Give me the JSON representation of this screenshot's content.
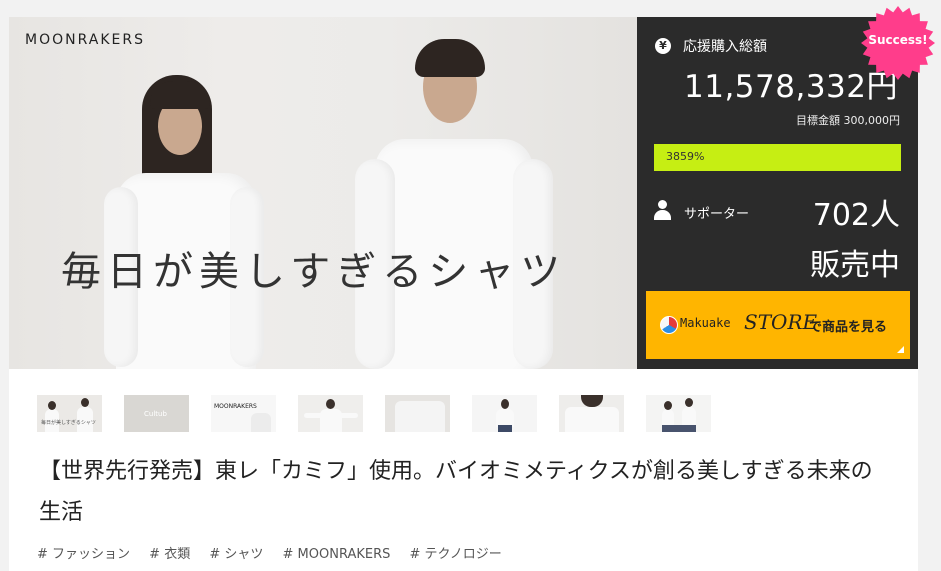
{
  "hero": {
    "brand": "MOONRAKERS",
    "tagline": "毎日が美しすぎるシャツ"
  },
  "panel": {
    "amount_label": "応援購入総額",
    "amount": "11,578,332円",
    "goal": "目標金額 300,000円",
    "progress_text": "3859%",
    "progress_percent": 3859,
    "supporter_label": "サポーター",
    "supporter_count": "702人",
    "status": "販売中",
    "success_badge": "Success!",
    "store_button": {
      "brand": "Makuake",
      "store": "STORE",
      "label": "で商品を見る"
    }
  },
  "thumbnails": [
    {
      "name": "thumb-1",
      "caption": "毎日が美しすぎるシャツ"
    },
    {
      "name": "thumb-2",
      "caption": "Cultub"
    },
    {
      "name": "thumb-3",
      "caption": "MOONRAKERS"
    },
    {
      "name": "thumb-4",
      "caption": ""
    },
    {
      "name": "thumb-5",
      "caption": ""
    },
    {
      "name": "thumb-6",
      "caption": ""
    },
    {
      "name": "thumb-7",
      "caption": ""
    },
    {
      "name": "thumb-8",
      "caption": ""
    }
  ],
  "title": "【世界先行発売】東レ「カミフ」使用。バイオミメティクスが創る美しすぎる未来の生活",
  "tags": [
    "# ファッション",
    "# 衣類",
    "# シャツ",
    "# MOONRAKERS",
    "# テクノロジー"
  ],
  "colors": {
    "panel_bg": "#2b2b2b",
    "progress": "#c6ee13",
    "store_button": "#ffb500",
    "success_badge": "#ff3d8b"
  }
}
